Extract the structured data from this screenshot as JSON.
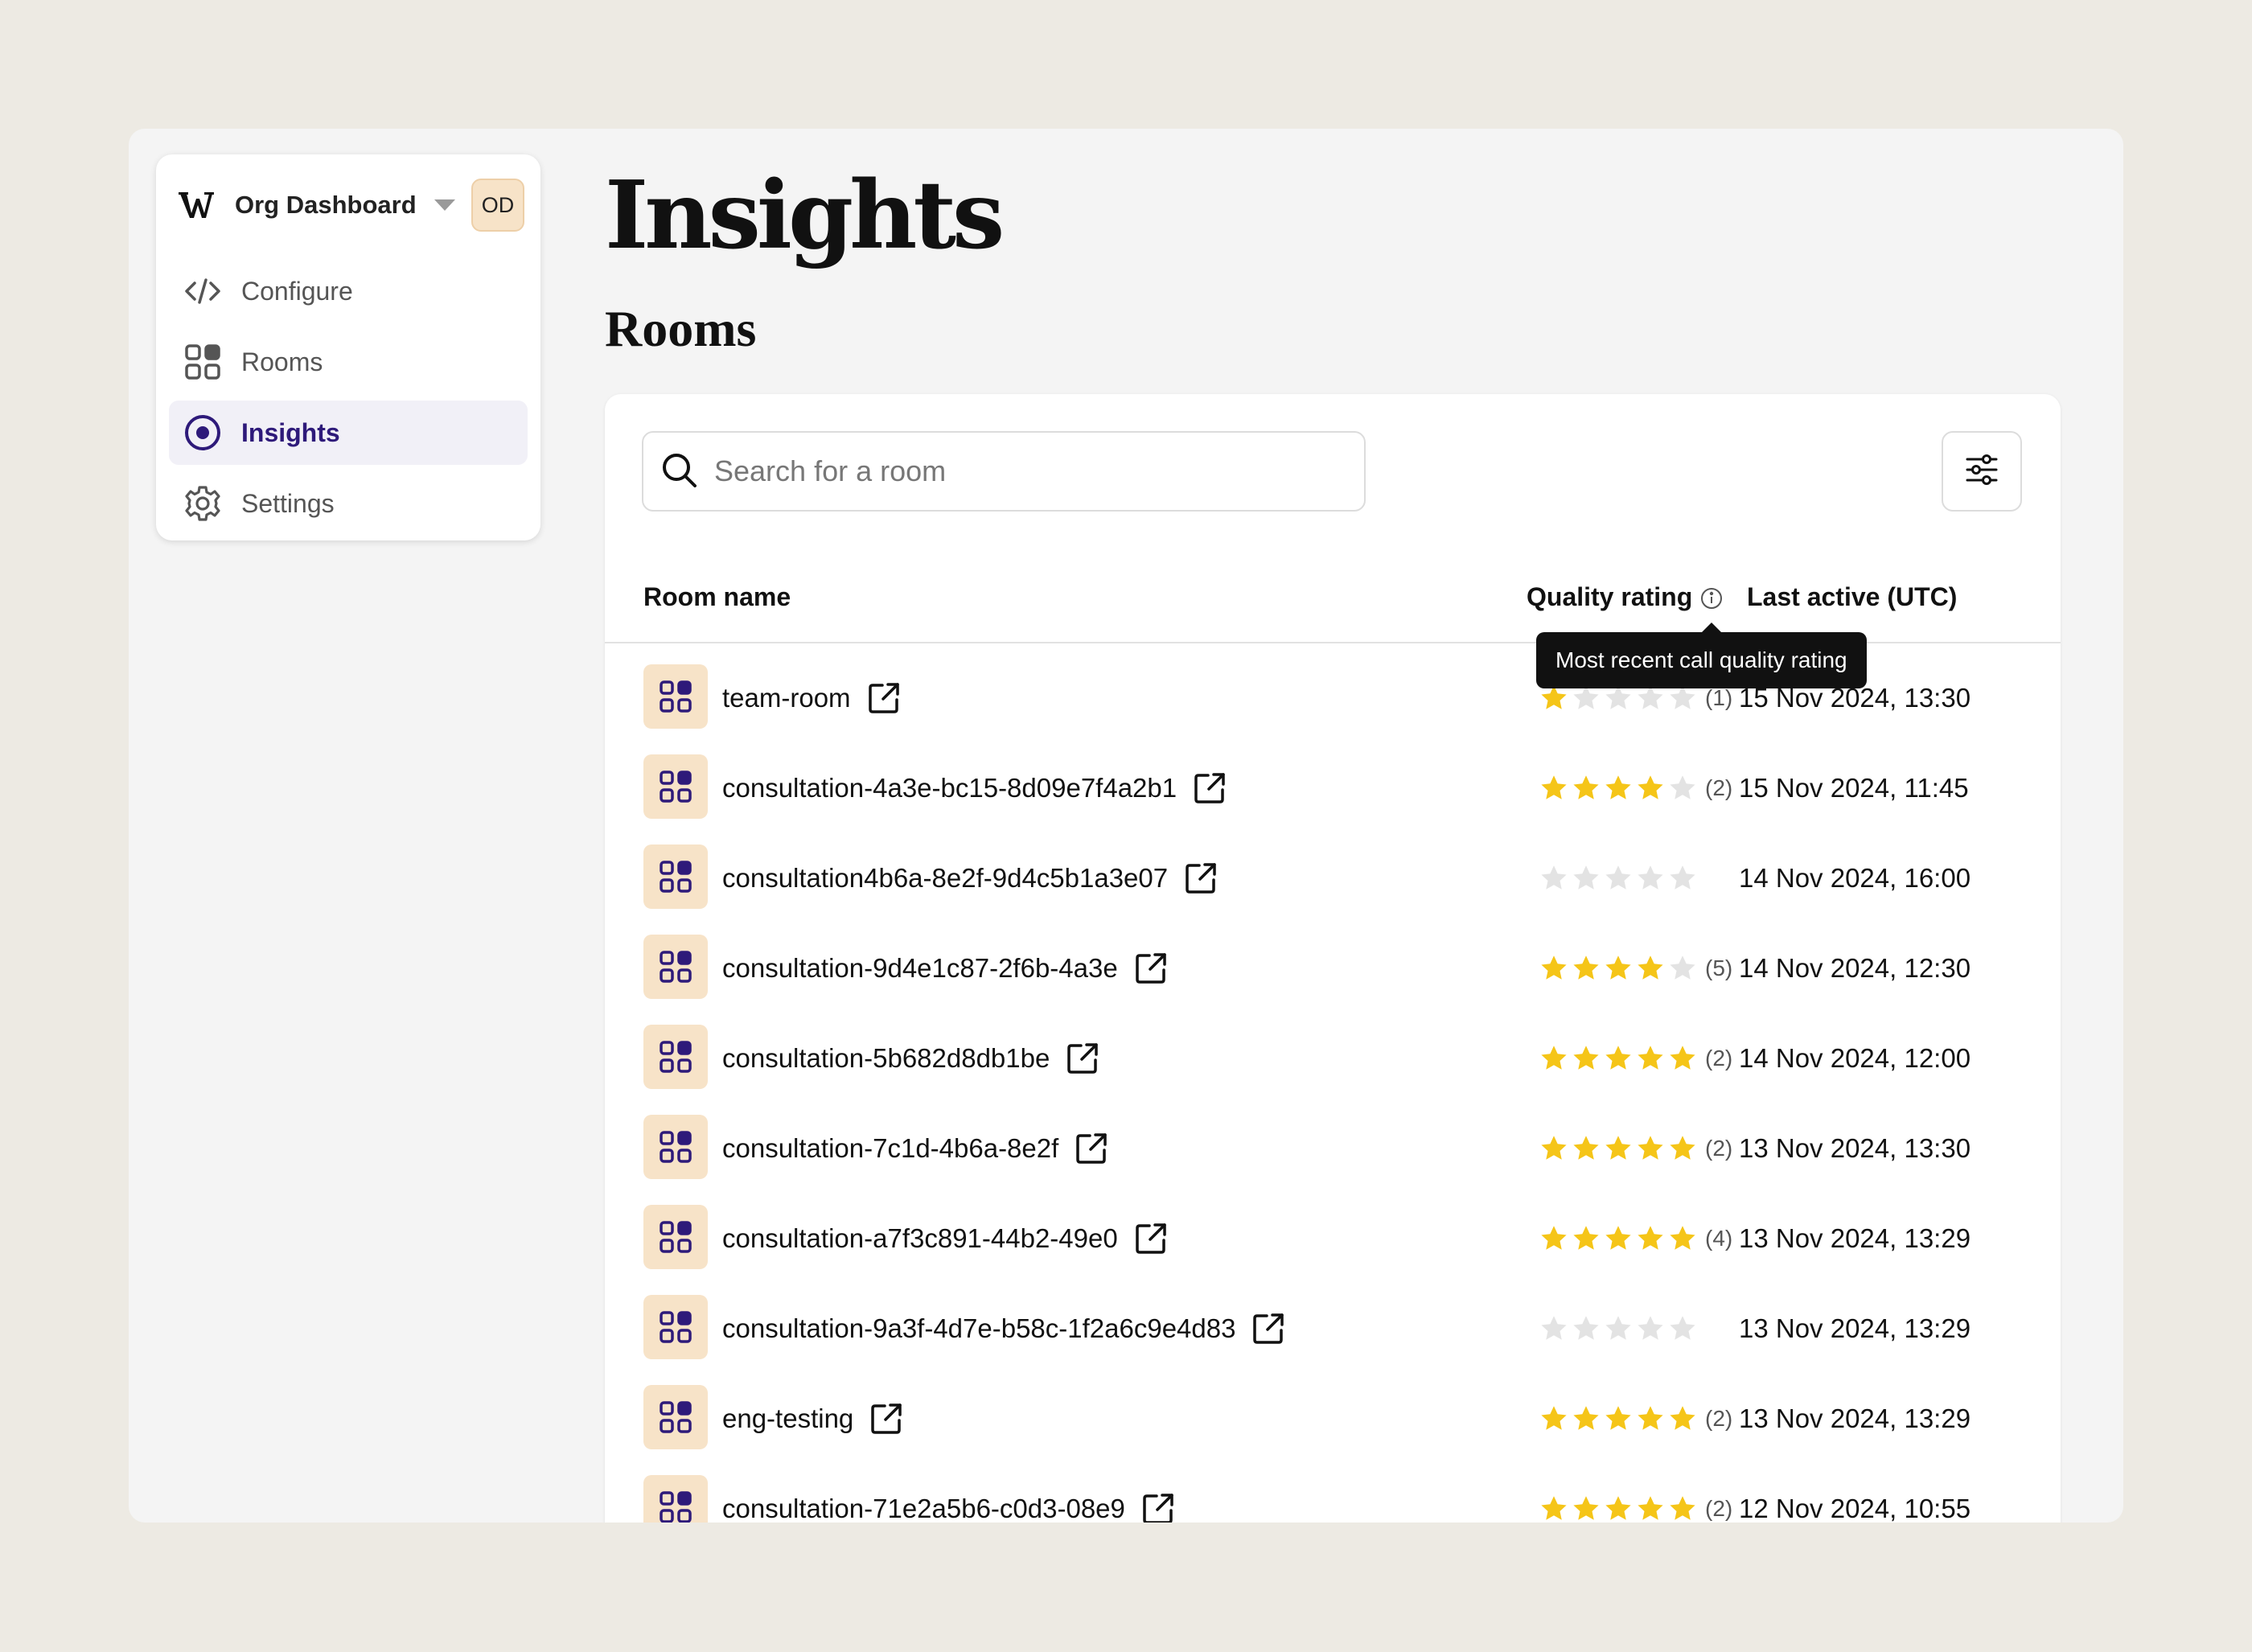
{
  "sidebar": {
    "org_name": "Org Dashboard",
    "avatar_initials": "OD",
    "items": [
      {
        "label": "Configure",
        "icon": "code-icon",
        "active": false
      },
      {
        "label": "Rooms",
        "icon": "grid-icon",
        "active": false
      },
      {
        "label": "Insights",
        "icon": "target-icon",
        "active": true
      },
      {
        "label": "Settings",
        "icon": "gear-icon",
        "active": false
      }
    ]
  },
  "main": {
    "title": "Insights",
    "subtitle": "Rooms",
    "search_placeholder": "Search for a room",
    "columns": {
      "name": "Room name",
      "quality": "Quality rating",
      "last_active": "Last active (UTC)"
    },
    "tooltip": "Most recent call quality rating",
    "rows": [
      {
        "name": "team-room",
        "rating": 1,
        "count": "(1)",
        "last_active": "15 Nov 2024, 13:30"
      },
      {
        "name": "consultation-4a3e-bc15-8d09e7f4a2b1",
        "rating": 4,
        "count": "(2)",
        "last_active": "15 Nov 2024, 11:45"
      },
      {
        "name": "consultation4b6a-8e2f-9d4c5b1a3e07",
        "rating": 0,
        "count": "",
        "last_active": "14 Nov 2024, 16:00"
      },
      {
        "name": "consultation-9d4e1c87-2f6b-4a3e",
        "rating": 4,
        "count": "(5)",
        "last_active": "14 Nov 2024, 12:30"
      },
      {
        "name": "consultation-5b682d8db1be",
        "rating": 5,
        "count": "(2)",
        "last_active": "14 Nov 2024, 12:00"
      },
      {
        "name": "consultation-7c1d-4b6a-8e2f",
        "rating": 5,
        "count": "(2)",
        "last_active": "13 Nov 2024, 13:30"
      },
      {
        "name": "consultation-a7f3c891-44b2-49e0",
        "rating": 5,
        "count": "(4)",
        "last_active": "13 Nov 2024, 13:29"
      },
      {
        "name": "consultation-9a3f-4d7e-b58c-1f2a6c9e4d83",
        "rating": 0,
        "count": "",
        "last_active": "13 Nov 2024, 13:29"
      },
      {
        "name": "eng-testing",
        "rating": 5,
        "count": "(2)",
        "last_active": "13 Nov 2024, 13:29"
      },
      {
        "name": "consultation-71e2a5b6-c0d3-08e9",
        "rating": 5,
        "count": "(2)",
        "last_active": "12 Nov 2024, 10:55"
      }
    ]
  },
  "colors": {
    "accent": "#2e1a7a",
    "star_filled": "#f5c518",
    "star_empty": "#e3e3e3",
    "room_icon_bg": "#f7e3c8"
  }
}
